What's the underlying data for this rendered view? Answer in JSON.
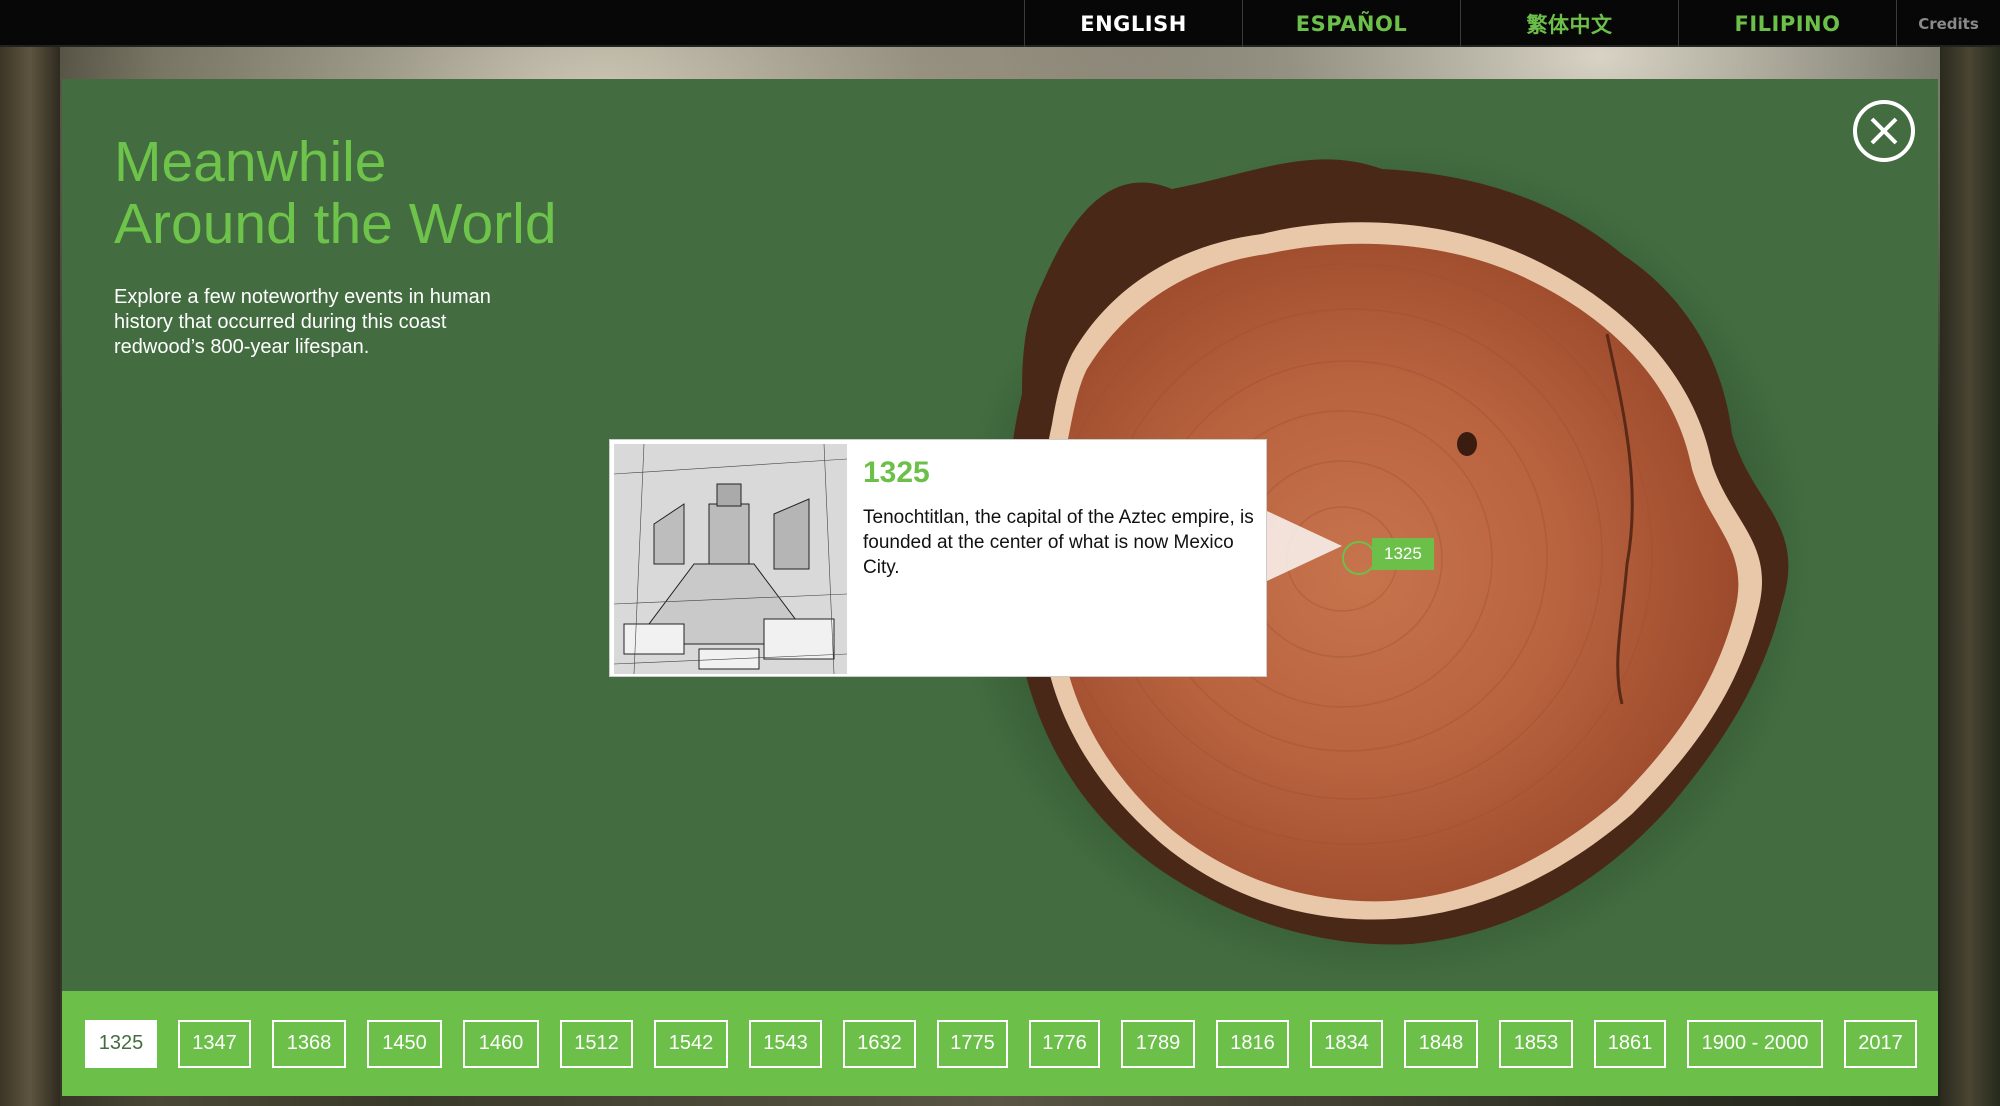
{
  "topbar": {
    "languages": [
      {
        "label": "ENGLISH",
        "active": true
      },
      {
        "label": "ESPAÑOL",
        "active": false
      },
      {
        "label": "繁体中文",
        "active": false
      },
      {
        "label": "FILIPINO",
        "active": false
      }
    ],
    "credits_label": "Credits"
  },
  "panel": {
    "title_line1": "Meanwhile",
    "title_line2": "Around the World",
    "intro": "Explore a few noteworthy events in human history that occurred during this coast redwood’s 800-year lifespan.",
    "close_icon": "close-icon"
  },
  "popup": {
    "year": "1325",
    "text": "Tenochtitlan, the capital of the Aztec empire, is founded at the center of what is now Mexico City.",
    "image_icon": "aztec-city-engraving"
  },
  "ring_tag": "1325",
  "timeline": {
    "years": [
      "1325",
      "1347",
      "1368",
      "1450",
      "1460",
      "1512",
      "1542",
      "1543",
      "1632",
      "1775",
      "1776",
      "1789",
      "1816",
      "1834",
      "1848",
      "1853",
      "1861",
      "1900 - 2000",
      "2017"
    ],
    "active": "1325"
  },
  "colors": {
    "panel_green": "#436d41",
    "accent_green": "#6cc04a",
    "topbar": "#070707"
  }
}
